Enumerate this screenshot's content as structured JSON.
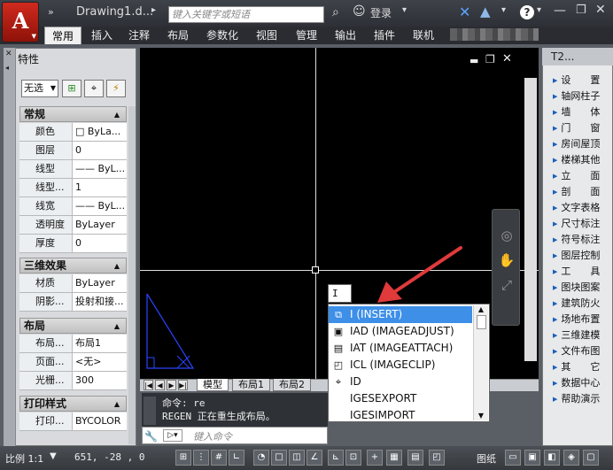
{
  "app": {
    "title": "Drawing1.d...",
    "search_placeholder": "键入关键字或短语",
    "login": "登录",
    "help": "?"
  },
  "ribbon_tabs": [
    "常用",
    "插入",
    "注释",
    "布局",
    "参数化",
    "视图",
    "管理",
    "输出",
    "插件",
    "联机"
  ],
  "properties": {
    "selection": "无选",
    "sections": [
      {
        "title": "常规",
        "rows": [
          [
            "颜色",
            "□ ByLa..."
          ],
          [
            "图层",
            "0"
          ],
          [
            "线型",
            "—— ByL..."
          ],
          [
            "线型...",
            "1"
          ],
          [
            "线宽",
            "—— ByL..."
          ],
          [
            "透明度",
            "ByLayer"
          ],
          [
            "厚度",
            "0"
          ]
        ]
      },
      {
        "title": "三维效果",
        "rows": [
          [
            "材质",
            "ByLayer"
          ],
          [
            "阴影...",
            "投射和接..."
          ]
        ]
      },
      {
        "title": "布局",
        "rows": [
          [
            "布局...",
            "布局1"
          ],
          [
            "页面...",
            "<无>"
          ],
          [
            "光栅...",
            "300"
          ]
        ]
      },
      {
        "title": "打印样式",
        "rows": [
          [
            "打印...",
            "BYCOLOR"
          ]
        ]
      }
    ]
  },
  "palette_label": "特性",
  "layout_tabs": [
    "模型",
    "布局1",
    "布局2"
  ],
  "command": {
    "history": [
      "命令: re",
      "REGEN 正在重生成布局。"
    ],
    "placeholder": "键入命令",
    "typed": "I"
  },
  "autocomplete": [
    "I (INSERT)",
    "IAD (IMAGEADJUST)",
    "IAT (IMAGEATTACH)",
    "ICL (IMAGECLIP)",
    "ID",
    "IGESEXPORT",
    "IGESIMPORT"
  ],
  "tool_palette": {
    "title": "T2...",
    "items": [
      "设　　置",
      "轴网柱子",
      "墙　　体",
      "门　　窗",
      "房间屋顶",
      "楼梯其他",
      "立　　面",
      "剖　　面",
      "文字表格",
      "尺寸标注",
      "符号标注",
      "图层控制",
      "工　　具",
      "图块图案",
      "建筑防火",
      "场地布置",
      "三维建模",
      "文件布图",
      "其　　它",
      "数据中心",
      "帮助演示"
    ]
  },
  "status": {
    "scale": "比例 1:1",
    "coords": "651, -28 , 0",
    "label": "图纸"
  },
  "colors": {
    "canvas": "#000000",
    "accent": "#3d8fe8",
    "app_red": "#d02a1e",
    "arrow": "#e03a3a"
  }
}
